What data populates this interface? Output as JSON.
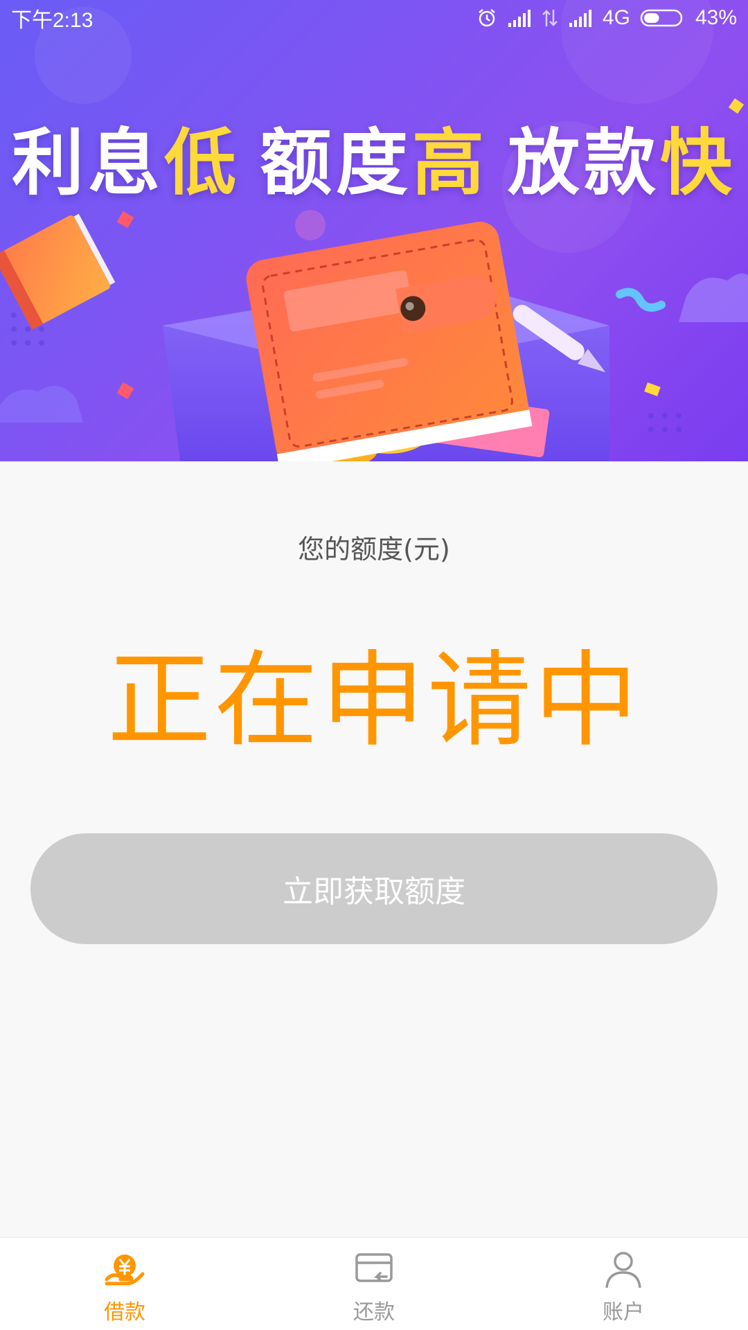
{
  "status_bar": {
    "time": "下午2:13",
    "network": "4G",
    "battery": "43%",
    "battery_level": 0.43
  },
  "banner": {
    "headline": [
      {
        "text": "利息",
        "accent": false
      },
      {
        "text": "低",
        "accent": true
      },
      {
        "text": "额度",
        "accent": false
      },
      {
        "text": "高",
        "accent": true
      },
      {
        "text": "放款",
        "accent": false
      },
      {
        "text": "快",
        "accent": true
      }
    ],
    "colors": {
      "text": "#ffffff",
      "accent": "#ffd83a",
      "background": "#7a55f2"
    }
  },
  "quota": {
    "label": "您的额度(元)",
    "status": "正在申请中",
    "status_color": "#ff9600"
  },
  "apply_button": {
    "label": "立即获取额度",
    "color": "#cccccc"
  },
  "tab_bar": {
    "active_color": "#ff9600",
    "inactive_color": "#999999",
    "tabs": [
      {
        "label": "借款",
        "icon": "hand-yen-icon",
        "active": true
      },
      {
        "label": "还款",
        "icon": "card-return-icon",
        "active": false
      },
      {
        "label": "账户",
        "icon": "user-icon",
        "active": false
      }
    ]
  }
}
